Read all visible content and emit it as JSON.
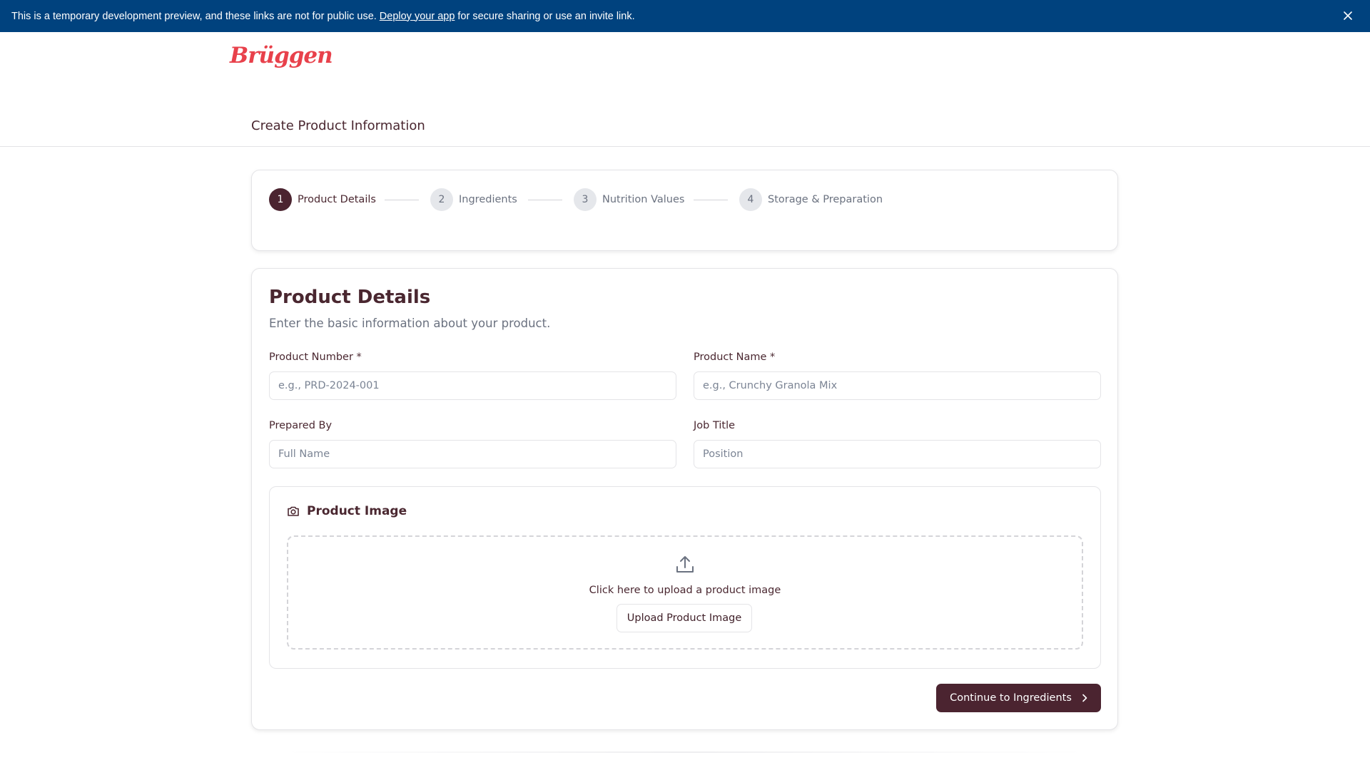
{
  "banner": {
    "text_before": "This is a temporary development preview, and these links are not for public use.",
    "link_text": "Deploy your app",
    "text_after": "for secure sharing or use an invite link."
  },
  "header": {
    "logo_text": "Brüggen",
    "page_title": "Create Product Information"
  },
  "stepper": {
    "steps": [
      {
        "number": "1",
        "label": "Product Details",
        "active": true
      },
      {
        "number": "2",
        "label": "Ingredients",
        "active": false
      },
      {
        "number": "3",
        "label": "Nutrition Values",
        "active": false
      },
      {
        "number": "4",
        "label": "Storage & Preparation",
        "active": false
      }
    ]
  },
  "form": {
    "title": "Product Details",
    "subtitle": "Enter the basic information about your product.",
    "fields": {
      "product_number": {
        "label": "Product Number *",
        "placeholder": "e.g., PRD-2024-001",
        "value": ""
      },
      "product_name": {
        "label": "Product Name *",
        "placeholder": "e.g., Crunchy Granola Mix",
        "value": ""
      },
      "prepared_by": {
        "label": "Prepared By",
        "placeholder": "Full Name",
        "value": ""
      },
      "job_title": {
        "label": "Job Title",
        "placeholder": "Position",
        "value": ""
      }
    },
    "image": {
      "title": "Product Image",
      "drop_text": "Click here to upload a product image",
      "upload_button": "Upload Product Image"
    },
    "continue_button": "Continue to Ingredients"
  },
  "colors": {
    "banner_bg": "#00427e",
    "primary": "#4b2430",
    "logo": "#e8414b"
  },
  "icons": {
    "banner_close": "close-icon",
    "image_section": "camera-icon",
    "dropzone": "upload-icon",
    "continue": "chevron-right-icon"
  }
}
